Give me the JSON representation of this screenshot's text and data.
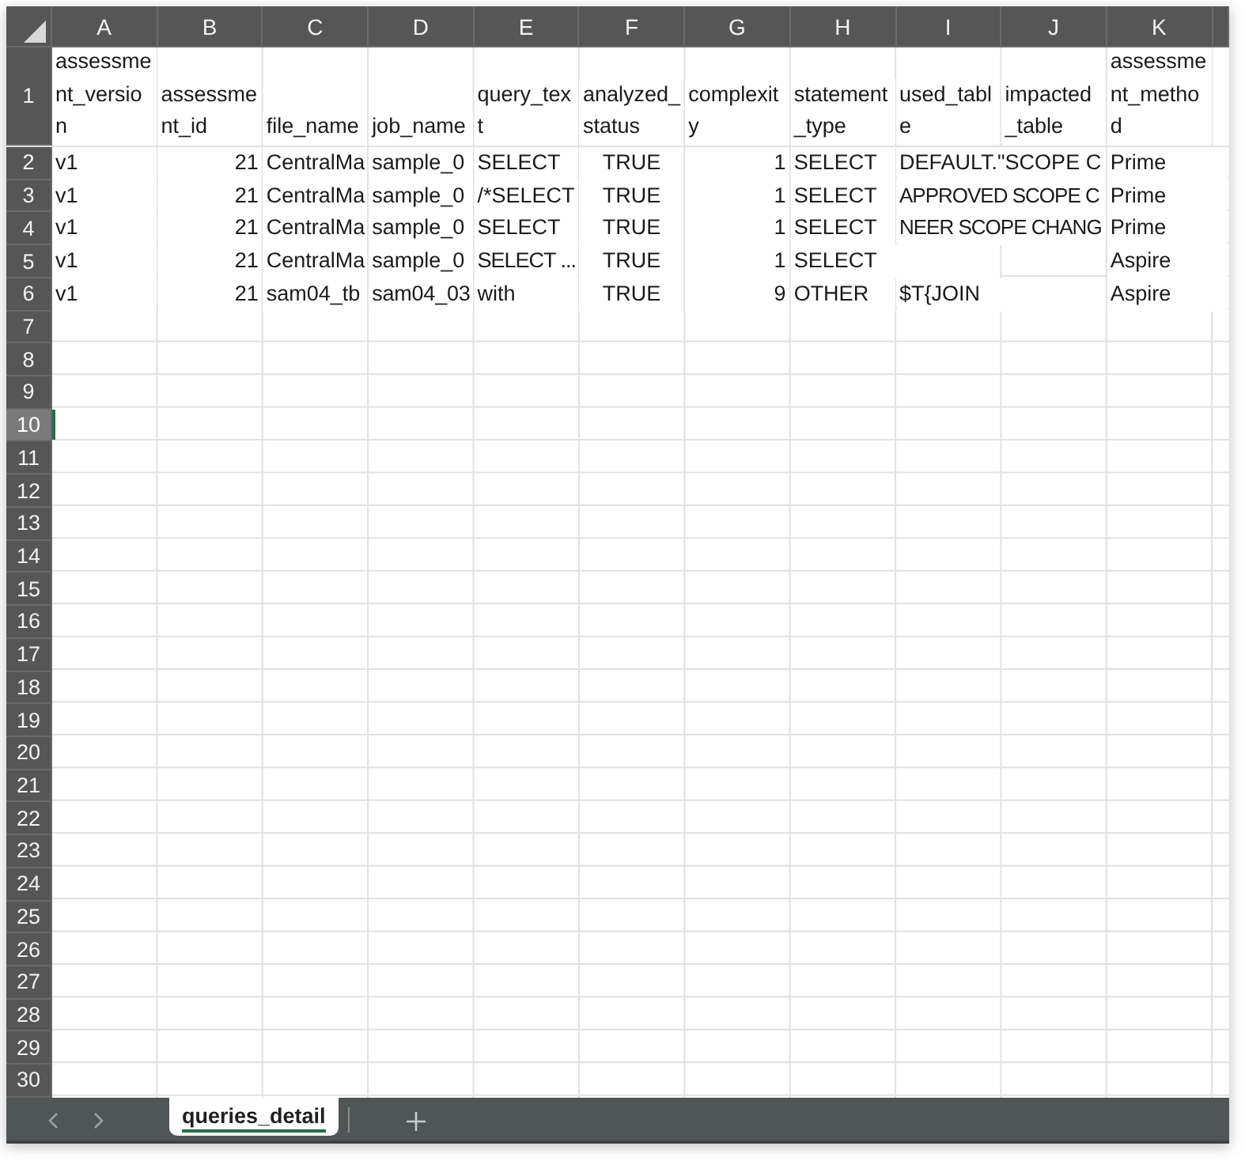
{
  "columns": [
    {
      "letter": "A",
      "kind": "text"
    },
    {
      "letter": "B",
      "kind": "number"
    },
    {
      "letter": "C",
      "kind": "text"
    },
    {
      "letter": "D",
      "kind": "text"
    },
    {
      "letter": "E",
      "kind": "text"
    },
    {
      "letter": "F",
      "kind": "boolean"
    },
    {
      "letter": "G",
      "kind": "number"
    },
    {
      "letter": "H",
      "kind": "text"
    },
    {
      "letter": "I",
      "kind": "text"
    },
    {
      "letter": "J",
      "kind": "text"
    },
    {
      "letter": "K",
      "kind": "text"
    }
  ],
  "rows": [
    {
      "number": "1",
      "kind": "header",
      "selected": false,
      "cells": {
        "A": "assessment_version",
        "B": "assessment_id",
        "C": "file_name",
        "D": "job_name",
        "E": "query_text",
        "F": "analyzed_status",
        "G": "complexity",
        "H": "statement_type",
        "I": "used_table",
        "J": "impacted_table",
        "K": "assessment_method"
      }
    },
    {
      "number": "2",
      "kind": "data",
      "selected": false,
      "cells": {
        "A": "v1",
        "B": "21",
        "C": "CentralMa",
        "D": "sample_0",
        "E": "SELECT",
        "F": "TRUE",
        "G": "1",
        "H": "SELECT",
        "I": "DEFAULT.\"SCOPE C",
        "K": "Prime"
      }
    },
    {
      "number": "3",
      "kind": "data",
      "selected": false,
      "cells": {
        "A": "v1",
        "B": "21",
        "C": "CentralMa",
        "D": "sample_0",
        "E": "/*SELECT",
        "F": "TRUE",
        "G": "1",
        "H": "SELECT",
        "I": "APPROVED SCOPE C",
        "K": "Prime"
      }
    },
    {
      "number": "4",
      "kind": "data",
      "selected": false,
      "cells": {
        "A": "v1",
        "B": "21",
        "C": "CentralMa",
        "D": "sample_0",
        "E": "SELECT",
        "F": "TRUE",
        "G": "1",
        "H": "SELECT",
        "I": "NEER SCOPE CHANG",
        "K": "Prime"
      }
    },
    {
      "number": "5",
      "kind": "data",
      "selected": false,
      "cells": {
        "A": "v1",
        "B": "21",
        "C": "CentralMa",
        "D": "sample_0",
        "E": "SELECT ...",
        "F": "TRUE",
        "G": "1",
        "H": "SELECT",
        "K": "Aspire"
      }
    },
    {
      "number": "6",
      "kind": "data",
      "selected": false,
      "cells": {
        "A": "v1",
        "B": "21",
        "C": "sam04_tb",
        "D": "sam04_03",
        "E": "with",
        "F": "TRUE",
        "G": "9",
        "H": "OTHER",
        "I": "$T{JOIN",
        "K": "Aspire"
      }
    },
    {
      "number": "7",
      "kind": "data",
      "selected": false
    },
    {
      "number": "8",
      "kind": "data",
      "selected": false
    },
    {
      "number": "9",
      "kind": "data",
      "selected": false
    },
    {
      "number": "10",
      "kind": "data",
      "selected": true
    },
    {
      "number": "11",
      "kind": "data",
      "selected": false
    },
    {
      "number": "12",
      "kind": "data",
      "selected": false
    },
    {
      "number": "13",
      "kind": "data",
      "selected": false
    },
    {
      "number": "14",
      "kind": "data",
      "selected": false
    },
    {
      "number": "15",
      "kind": "data",
      "selected": false
    },
    {
      "number": "16",
      "kind": "data",
      "selected": false
    },
    {
      "number": "17",
      "kind": "data",
      "selected": false
    },
    {
      "number": "18",
      "kind": "data",
      "selected": false
    },
    {
      "number": "19",
      "kind": "data",
      "selected": false
    },
    {
      "number": "20",
      "kind": "data",
      "selected": false
    },
    {
      "number": "21",
      "kind": "data",
      "selected": false
    },
    {
      "number": "22",
      "kind": "data",
      "selected": false
    },
    {
      "number": "23",
      "kind": "data",
      "selected": false
    },
    {
      "number": "24",
      "kind": "data",
      "selected": false
    },
    {
      "number": "25",
      "kind": "data",
      "selected": false
    },
    {
      "number": "26",
      "kind": "data",
      "selected": false
    },
    {
      "number": "27",
      "kind": "data",
      "selected": false
    },
    {
      "number": "28",
      "kind": "data",
      "selected": false
    },
    {
      "number": "29",
      "kind": "data",
      "selected": false
    },
    {
      "number": "30",
      "kind": "data",
      "selected": false
    }
  ],
  "sheet_tabs": [
    {
      "label": "queries_detail",
      "selected": true
    }
  ]
}
